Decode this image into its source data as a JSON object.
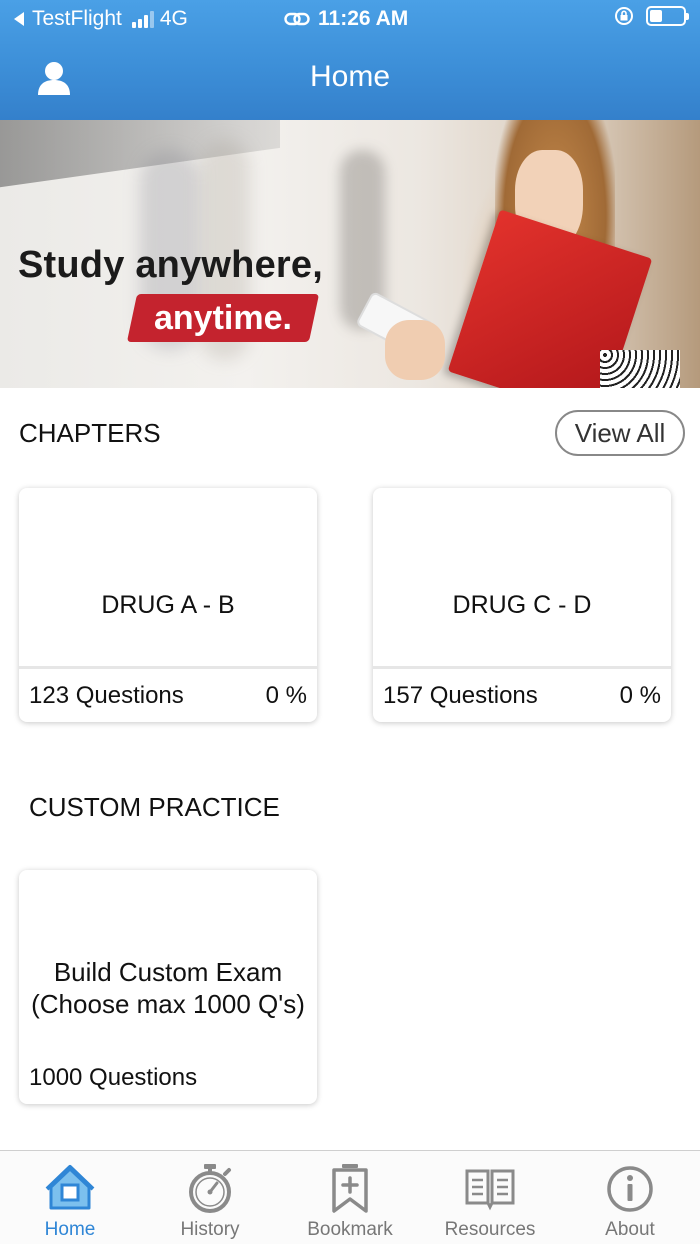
{
  "status_bar": {
    "carrier": "TestFlight",
    "network": "4G",
    "time": "11:26 AM"
  },
  "nav": {
    "title": "Home",
    "profile_icon": "person-icon"
  },
  "banner": {
    "line1": "Study anywhere,",
    "line2": "anytime."
  },
  "chapters": {
    "heading": "CHAPTERS",
    "view_all_label": "View All",
    "items": [
      {
        "title": "DRUG A - B",
        "questions": "123 Questions",
        "progress": "0 %"
      },
      {
        "title": "DRUG C - D",
        "questions": "157 Questions",
        "progress": "0 %"
      }
    ]
  },
  "custom_practice": {
    "heading": "CUSTOM PRACTICE",
    "card": {
      "title_line1": "Build Custom Exam",
      "title_line2": "(Choose max 1000 Q's)",
      "questions": "1000 Questions"
    }
  },
  "tabbar": {
    "items": [
      {
        "label": "Home",
        "icon": "home-icon",
        "active": true
      },
      {
        "label": "History",
        "icon": "stopwatch-icon",
        "active": false
      },
      {
        "label": "Bookmark",
        "icon": "bookmark-icon",
        "active": false
      },
      {
        "label": "Resources",
        "icon": "book-icon",
        "active": false
      },
      {
        "label": "About",
        "icon": "info-icon",
        "active": false
      }
    ]
  },
  "colors": {
    "nav_blue": "#3d8fd8",
    "tab_active": "#2f86d6",
    "banner_red": "#c4232e"
  }
}
